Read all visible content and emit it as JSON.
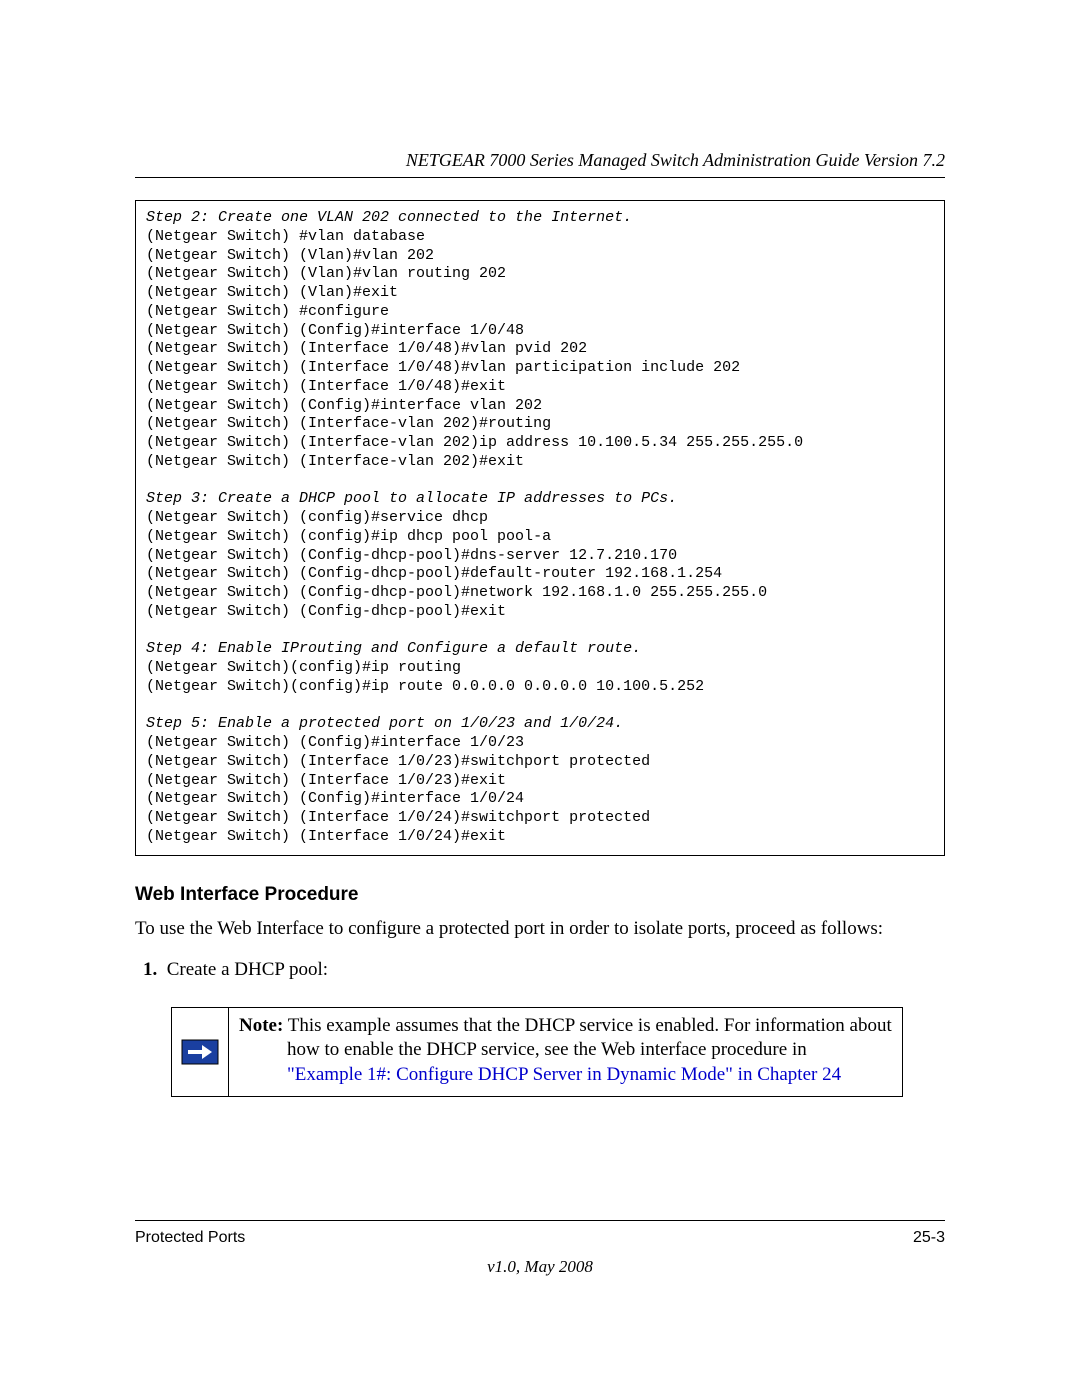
{
  "header": {
    "title": "NETGEAR 7000 Series Managed Switch Administration Guide Version 7.2"
  },
  "code": {
    "step2_title": "Step 2: Create one VLAN 202 connected to the Internet.",
    "step2_body": "(Netgear Switch) #vlan database\n(Netgear Switch) (Vlan)#vlan 202\n(Netgear Switch) (Vlan)#vlan routing 202\n(Netgear Switch) (Vlan)#exit\n(Netgear Switch) #configure\n(Netgear Switch) (Config)#interface 1/0/48\n(Netgear Switch) (Interface 1/0/48)#vlan pvid 202\n(Netgear Switch) (Interface 1/0/48)#vlan participation include 202\n(Netgear Switch) (Interface 1/0/48)#exit\n(Netgear Switch) (Config)#interface vlan 202\n(Netgear Switch) (Interface-vlan 202)#routing\n(Netgear Switch) (Interface-vlan 202)ip address 10.100.5.34 255.255.255.0\n(Netgear Switch) (Interface-vlan 202)#exit",
    "step3_title": "Step 3: Create a DHCP pool to allocate IP addresses to PCs.",
    "step3_body": "(Netgear Switch) (config)#service dhcp\n(Netgear Switch) (config)#ip dhcp pool pool-a\n(Netgear Switch) (Config-dhcp-pool)#dns-server 12.7.210.170\n(Netgear Switch) (Config-dhcp-pool)#default-router 192.168.1.254\n(Netgear Switch) (Config-dhcp-pool)#network 192.168.1.0 255.255.255.0\n(Netgear Switch) (Config-dhcp-pool)#exit",
    "step4_title": "Step 4: Enable IProuting and Configure a default route.",
    "step4_body": "(Netgear Switch)(config)#ip routing\n(Netgear Switch)(config)#ip route 0.0.0.0 0.0.0.0 10.100.5.252",
    "step5_title": "Step 5: Enable a protected port on 1/0/23 and 1/0/24.",
    "step5_body": "(Netgear Switch) (Config)#interface 1/0/23\n(Netgear Switch) (Interface 1/0/23)#switchport protected\n(Netgear Switch) (Interface 1/0/23)#exit\n(Netgear Switch) (Config)#interface 1/0/24\n(Netgear Switch) (Interface 1/0/24)#switchport protected\n(Netgear Switch) (Interface 1/0/24)#exit"
  },
  "section": {
    "title": "Web Interface Procedure",
    "intro": "To use the Web Interface to configure a protected port in order to isolate ports, proceed as follows:",
    "item1_num": "1.",
    "item1_text": "Create a DHCP pool:"
  },
  "note": {
    "label": "Note:",
    "line1": " This example assumes that the DHCP service is enabled. For information about ",
    "line2": "how to enable the DHCP service, see the Web interface procedure in ",
    "xref": "\"Example 1#: Configure DHCP Server in Dynamic Mode\" in Chapter 24"
  },
  "footer": {
    "left": "Protected Ports",
    "right": "25-3",
    "version": "v1.0, May 2008"
  }
}
